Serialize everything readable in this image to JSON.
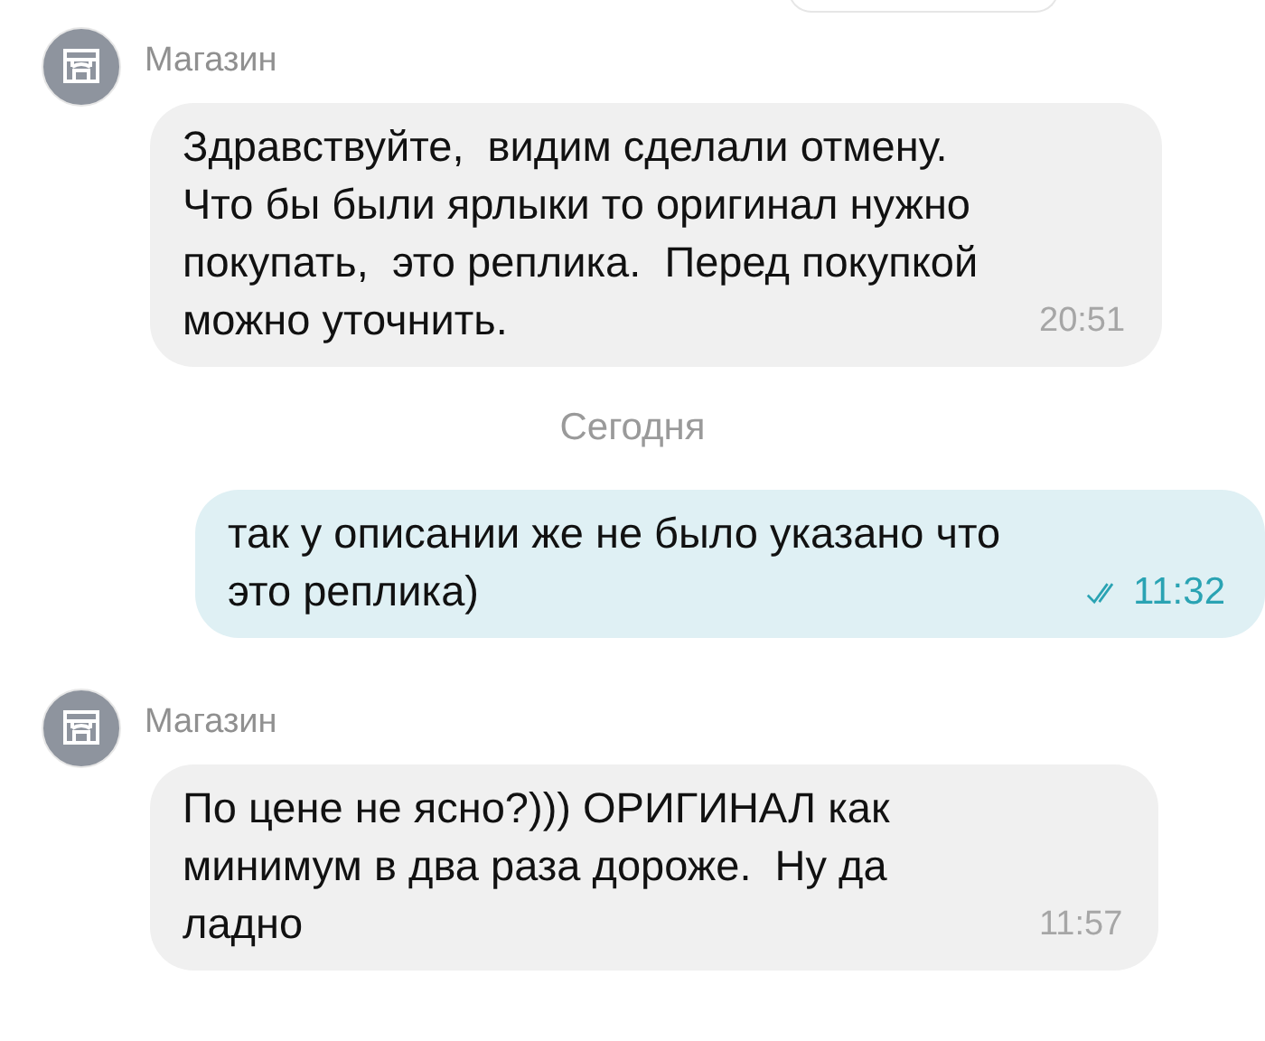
{
  "messages": [
    {
      "kind": "cut"
    },
    {
      "kind": "incoming",
      "sender": "Магазин",
      "text": "Здравствуйте,  видим сделали отмену. Что бы были ярлыки то оригинал нужно покупать,  это реплика.  Перед покупкой можно уточнить.",
      "time": "20:51"
    },
    {
      "kind": "date",
      "text": "Сегодня"
    },
    {
      "kind": "outgoing",
      "text": "так у описании же не было указано что это реплика)",
      "time": "11:32",
      "read": true
    },
    {
      "kind": "incoming",
      "sender": "Магазин",
      "text": "По цене не ясно?))) ОРИГИНАЛ как минимум в два раза дороже.  Ну да ладно",
      "time": "11:57"
    }
  ]
}
